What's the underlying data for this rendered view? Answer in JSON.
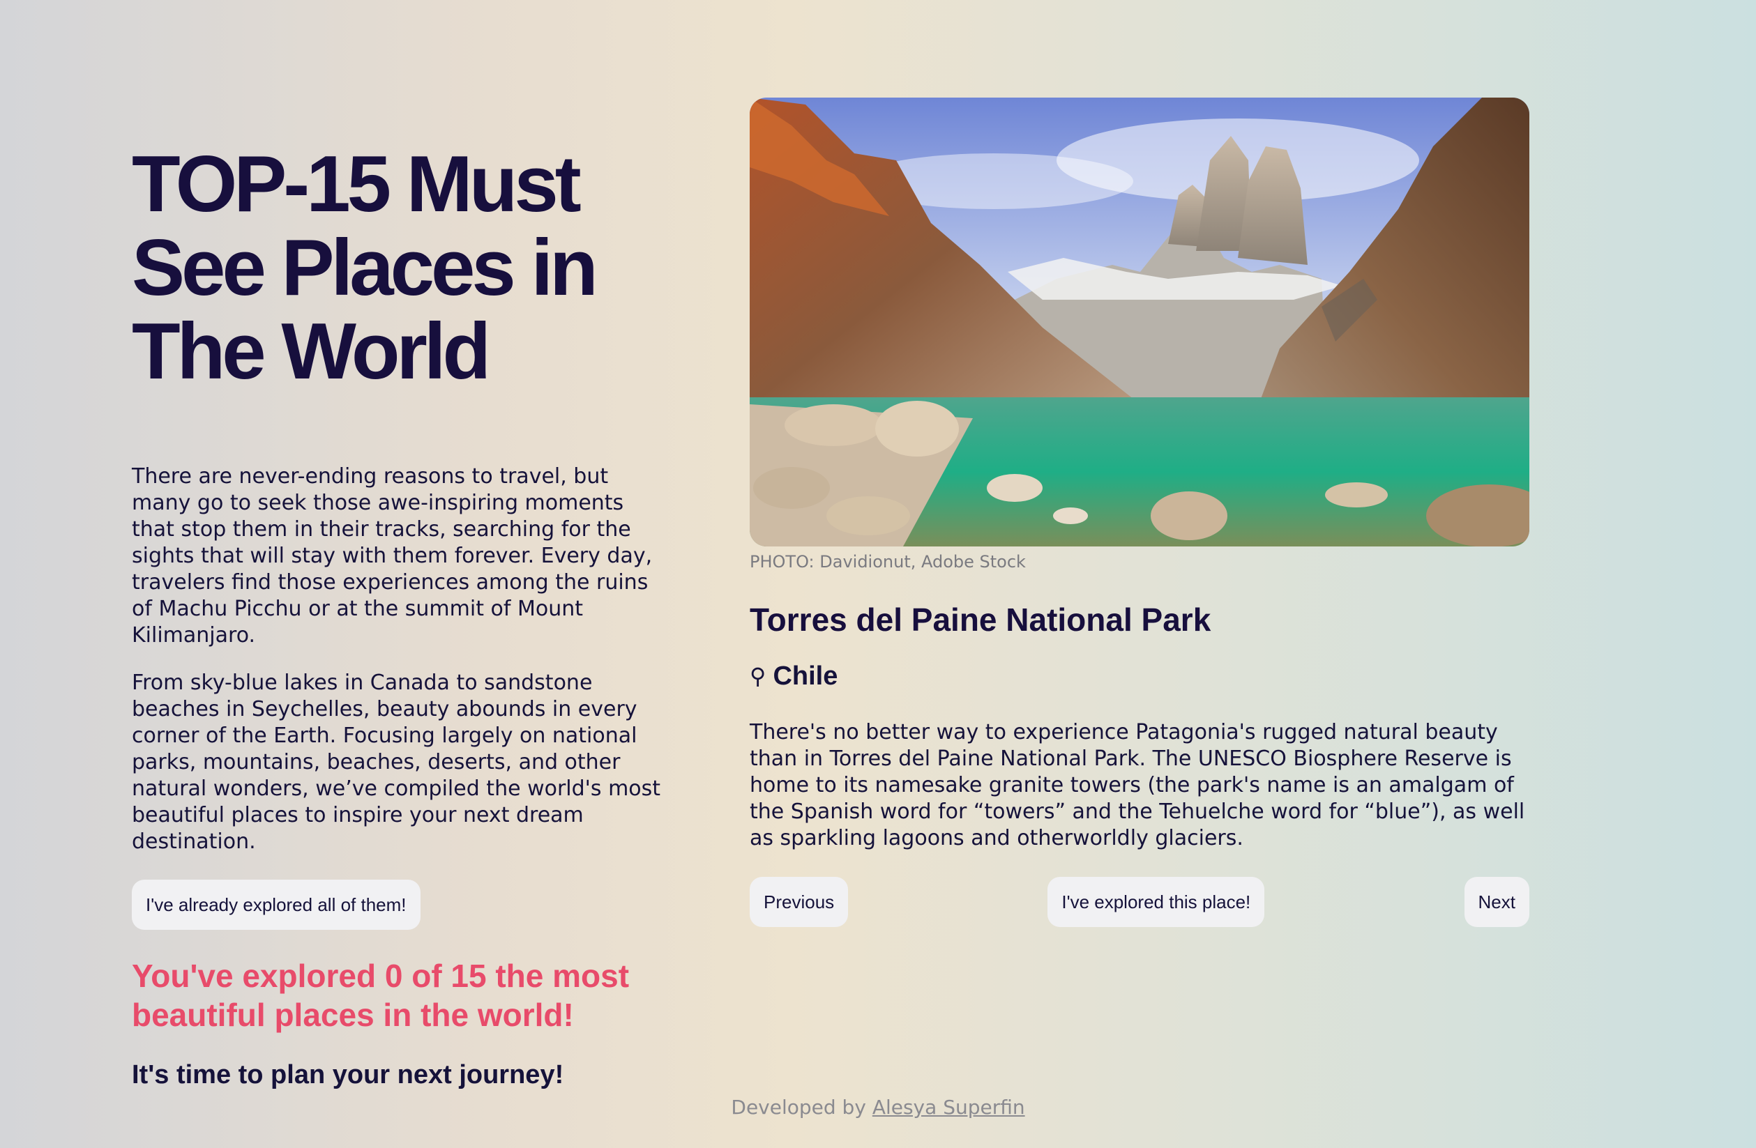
{
  "hero": {
    "title": "TOP-15 Must See Places in The World",
    "paragraphs": [
      "There are never-ending reasons to travel, but many go to seek those awe-inspiring moments that stop them in their tracks, searching for the sights that will stay with them forever. Every day, travelers find those experiences among the ruins of Machu Picchu or at the summit of Mount Kilimanjaro.",
      "From sky-blue lakes in Canada to sandstone beaches in Seychelles, beauty abounds in every corner of the Earth. Focusing largely on national parks, mountains, beaches, deserts, and other natural wonders, we’ve compiled the world's most beautiful places to inspire your next dream destination."
    ],
    "explored_all_button": "I've already explored all of them!",
    "progress_text": "You've explored 0 of 15 the most beautiful places in the world!",
    "journey_text": "It's time to plan your next journey!"
  },
  "place": {
    "photo_credit": "PHOTO: Davidionut, Adobe Stock",
    "name": "Torres del Paine National Park",
    "location_icon": "map-pin-icon",
    "pin_glyph": "⚲",
    "country": "Chile",
    "description": "There's no better way to experience Patagonia's rugged natural beauty than in Torres del Paine National Park. The UNESCO Biosphere Reserve is home to its namesake granite towers (the park's name is an amalgam of the Spanish word for “towers” and the Tehuelche word for “blue”), as well as sparkling lagoons and otherworldly glaciers."
  },
  "navigation": {
    "previous": "Previous",
    "explored": "I've explored this place!",
    "next": "Next"
  },
  "progress": {
    "explored": 0,
    "total": 15
  },
  "footer": {
    "prefix": "Developed by",
    "author": "Alesya Superfin"
  },
  "colors": {
    "accent_pink": "#e84b6a",
    "text_dark": "#15123a",
    "button_bg": "#f1f1f3"
  }
}
